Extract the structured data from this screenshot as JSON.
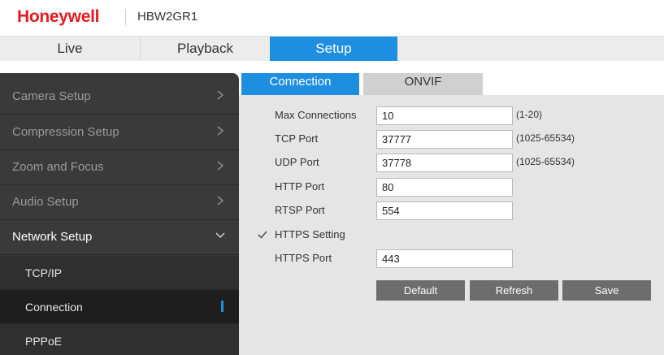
{
  "header": {
    "brand": "Honeywell",
    "model": "HBW2GR1",
    "brand_color": "#e31b23"
  },
  "topnav": {
    "tabs": [
      {
        "label": "Live"
      },
      {
        "label": "Playback"
      },
      {
        "label": "Setup",
        "active": true
      }
    ]
  },
  "sidebar": {
    "items": [
      {
        "label": "Camera Setup",
        "icon": "chevron-right-icon"
      },
      {
        "label": "Compression Setup",
        "icon": "chevron-right-icon"
      },
      {
        "label": "Zoom and Focus",
        "icon": "chevron-right-icon"
      },
      {
        "label": "Audio Setup",
        "icon": "chevron-right-icon"
      },
      {
        "label": "Network Setup",
        "icon": "chevron-down-icon",
        "expanded": true
      }
    ],
    "subitems": [
      {
        "label": "TCP/IP"
      },
      {
        "label": "Connection",
        "active": true
      },
      {
        "label": "PPPoE"
      }
    ]
  },
  "subtabs": [
    {
      "label": "Connection",
      "active": true
    },
    {
      "label": "ONVIF"
    }
  ],
  "form": {
    "max_connections": {
      "label": "Max Connections",
      "value": "10",
      "hint": "(1-20)"
    },
    "tcp_port": {
      "label": "TCP Port",
      "value": "37777",
      "hint": "(1025-65534)"
    },
    "udp_port": {
      "label": "UDP Port",
      "value": "37778",
      "hint": "(1025-65534)"
    },
    "http_port": {
      "label": "HTTP Port",
      "value": "80"
    },
    "rtsp_port": {
      "label": "RTSP Port",
      "value": "554"
    },
    "https_setting": {
      "label": "HTTPS Setting",
      "checked": true
    },
    "https_port": {
      "label": "HTTPS Port",
      "value": "443"
    }
  },
  "buttons": {
    "default": "Default",
    "refresh": "Refresh",
    "save": "Save"
  },
  "colors": {
    "accent": "#1e8fe0",
    "sidebar_bg": "#3a3a3a",
    "content_bg": "#e5e5e5",
    "button_bg": "#6d6d6d"
  }
}
